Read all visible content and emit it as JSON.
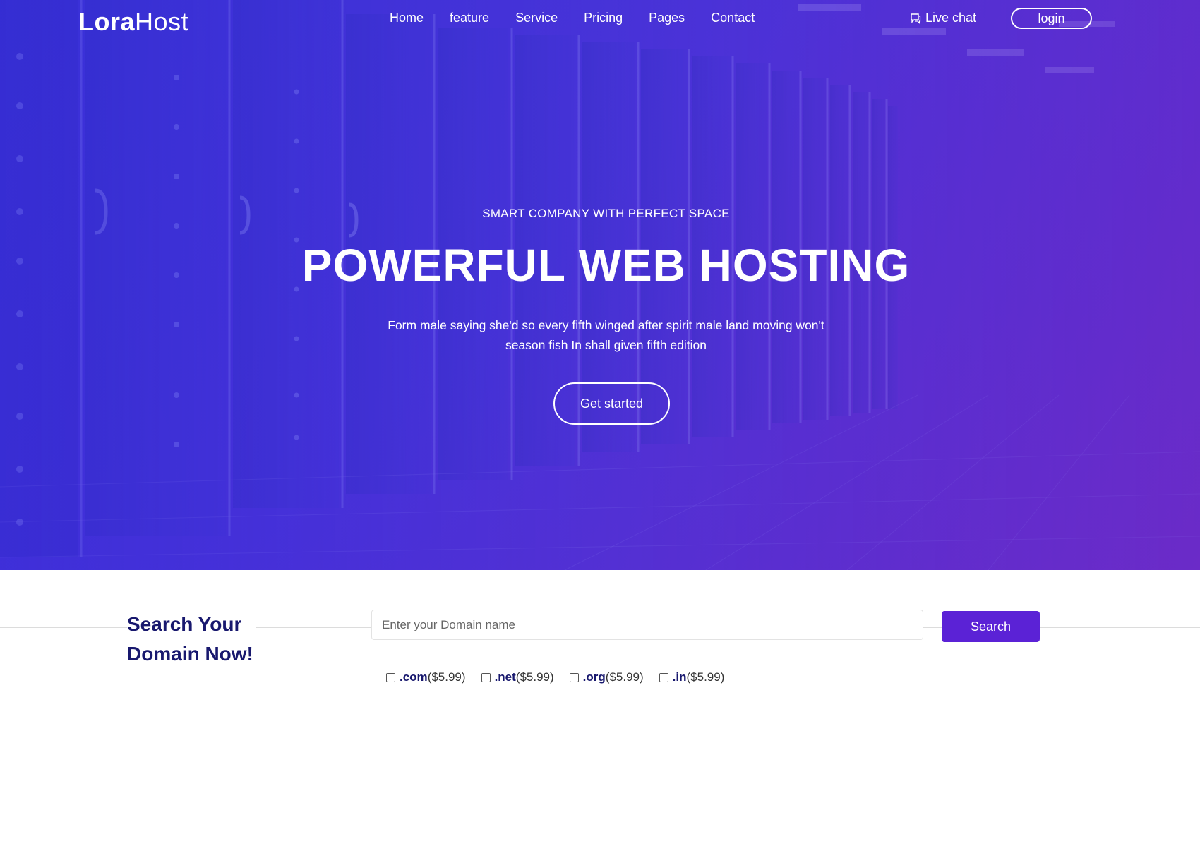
{
  "brand": {
    "logo_bold": "Lora",
    "logo_light": "Host"
  },
  "nav": {
    "items": [
      "Home",
      "feature",
      "Service",
      "Pricing",
      "Pages",
      "Contact"
    ],
    "live_chat": "Live chat",
    "login": "login"
  },
  "hero": {
    "tagline": "SMART COMPANY WITH PERFECT SPACE",
    "headline": "POWERFUL WEB HOSTING",
    "description": "Form male saying she'd so every fifth winged after spirit male land moving won't season fish In shall given fifth edition",
    "cta": "Get started"
  },
  "domain_search": {
    "title_line1": "Search Your",
    "title_line2": "Domain Now!",
    "placeholder": "Enter your Domain name",
    "button": "Search",
    "tlds": [
      {
        "ext": ".com",
        "price": "($5.99)"
      },
      {
        "ext": ".net",
        "price": "($5.99)"
      },
      {
        "ext": ".org",
        "price": "($5.99)"
      },
      {
        "ext": ".in",
        "price": "($5.99)"
      }
    ]
  },
  "colors": {
    "hero_gradient_start": "#3d35d6",
    "hero_gradient_end": "#6a2dc8",
    "title_navy": "#18186e",
    "search_button": "#5b22d6"
  }
}
